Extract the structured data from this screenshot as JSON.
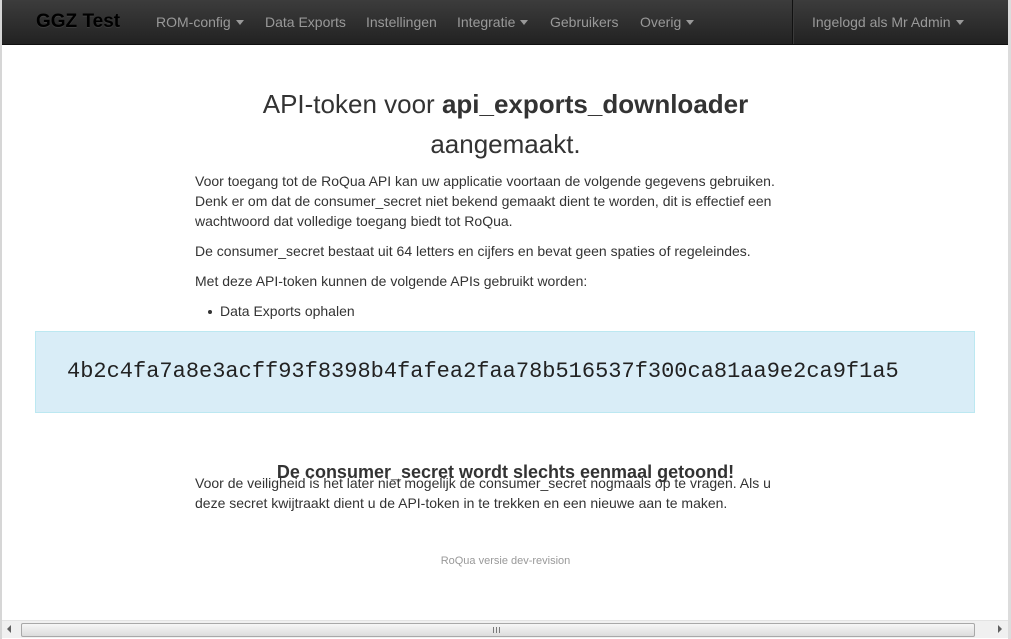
{
  "navbar": {
    "brand": "GGZ Test",
    "items": [
      {
        "label": "ROM-config",
        "dropdown": true
      },
      {
        "label": "Data Exports",
        "dropdown": false
      },
      {
        "label": "Instellingen",
        "dropdown": false
      },
      {
        "label": "Integratie",
        "dropdown": true
      },
      {
        "label": "Gebruikers",
        "dropdown": false
      },
      {
        "label": "Overig",
        "dropdown": true
      }
    ],
    "user_menu": "Ingelogd als Mr Admin"
  },
  "content": {
    "title_prefix": "API-token voor ",
    "title_name": "api_exports_downloader",
    "title_suffix": "aangemaakt.",
    "intro": "Voor toegang tot de RoQua API kan uw applicatie voortaan de volgende gegevens gebruiken. Denk er om dat de consumer_secret niet bekend gemaakt dient te worden, dit is effectief een wachtwoord dat volledige toegang biedt tot RoQua.",
    "secret_info": "De consumer_secret bestaat uit 64 letters en cijfers en bevat geen spaties of regeleindes.",
    "apis_intro": "Met deze API-token kunnen de volgende APIs gebruikt worden:",
    "apis": [
      "Data Exports ophalen"
    ],
    "token": "4b2c4fa7a8e3acff93f8398b4fafea2faa78b516537f300ca81aa9e2ca9f1a5",
    "warning": "De consumer_secret wordt slechts eenmaal getoond!",
    "warning_text": "Voor de veiligheid is het later niet mogelijk de consumer_secret nogmaals op te vragen. Als u deze secret kwijtraakt dient u de API-token in te trekken en een nieuwe aan te maken.",
    "footer": "RoQua versie dev-revision"
  },
  "colors": {
    "navbar_bg": "#222222",
    "nav_text": "#999999",
    "token_bg": "#d9edf7",
    "token_border": "#bce8f1"
  }
}
